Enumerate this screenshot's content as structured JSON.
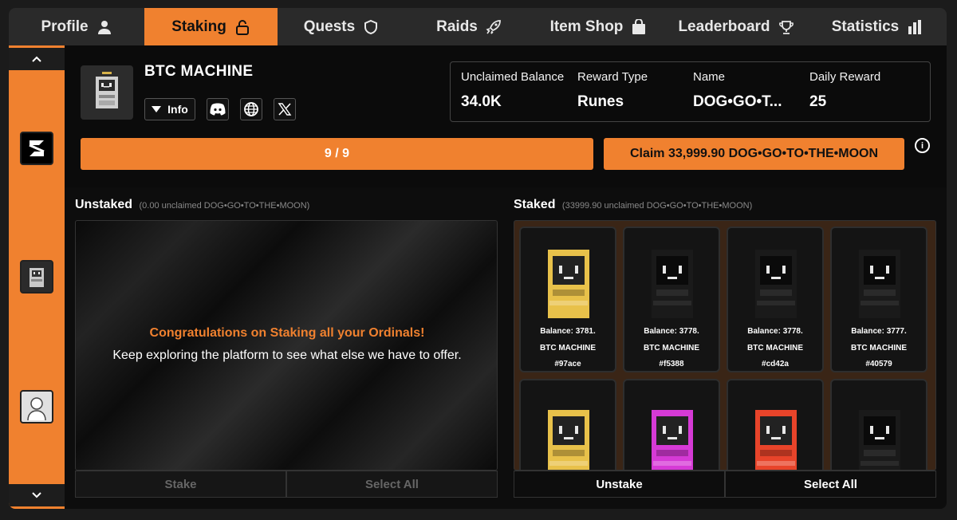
{
  "tabs": [
    {
      "label": "Profile",
      "icon": "user-icon",
      "active": false
    },
    {
      "label": "Staking",
      "icon": "unlock-icon",
      "active": true
    },
    {
      "label": "Quests",
      "icon": "shield-icon",
      "active": false
    },
    {
      "label": "Raids",
      "icon": "rocket-icon",
      "active": false
    },
    {
      "label": "Item Shop",
      "icon": "shopping-bag-icon",
      "active": false
    },
    {
      "label": "Leaderboard",
      "icon": "trophy-icon",
      "active": false
    },
    {
      "label": "Statistics",
      "icon": "bar-chart-icon",
      "active": false
    }
  ],
  "header": {
    "title": "BTC MACHINE",
    "info_label": "Info",
    "stats": [
      {
        "label": "Unclaimed Balance",
        "value": "34.0K"
      },
      {
        "label": "Reward Type",
        "value": "Runes"
      },
      {
        "label": "Name",
        "value": "DOG•GO•T..."
      },
      {
        "label": "Daily Reward",
        "value": "25"
      }
    ],
    "progress_text": "9 / 9",
    "claim_label": "Claim 33,999.90 DOG•GO•TO•THE•MOON"
  },
  "unstaked": {
    "title": "Unstaked",
    "subtitle": "(0.00 unclaimed DOG•GO•TO•THE•MOON)",
    "congrats": "Congratulations on Staking all your Ordinals!",
    "message": "Keep exploring the platform to see what else we have to offer.",
    "stake_label": "Stake",
    "select_all_label": "Select All"
  },
  "staked": {
    "title": "Staked",
    "subtitle": "(33999.90 unclaimed DOG•GO•TO•THE•MOON)",
    "unstake_label": "Unstake",
    "select_all_label": "Select All",
    "cards": [
      {
        "balance": "Balance: 3781.",
        "name": "BTC MACHINE",
        "hash": "#97ace",
        "color": "#e8c14a"
      },
      {
        "balance": "Balance: 3778.",
        "name": "BTC MACHINE",
        "hash": "#f5388",
        "color": "#1a1a1a"
      },
      {
        "balance": "Balance: 3778.",
        "name": "BTC MACHINE",
        "hash": "#cd42a",
        "color": "#1a1a1a"
      },
      {
        "balance": "Balance: 3777.",
        "name": "BTC MACHINE",
        "hash": "#40579",
        "color": "#1a1a1a"
      },
      {
        "balance": "",
        "name": "",
        "hash": "",
        "color": "#e8c14a"
      },
      {
        "balance": "",
        "name": "",
        "hash": "",
        "color": "#d63ad6"
      },
      {
        "balance": "",
        "name": "",
        "hash": "",
        "color": "#e8442a"
      },
      {
        "balance": "",
        "name": "",
        "hash": "",
        "color": "#1a1a1a"
      }
    ]
  }
}
